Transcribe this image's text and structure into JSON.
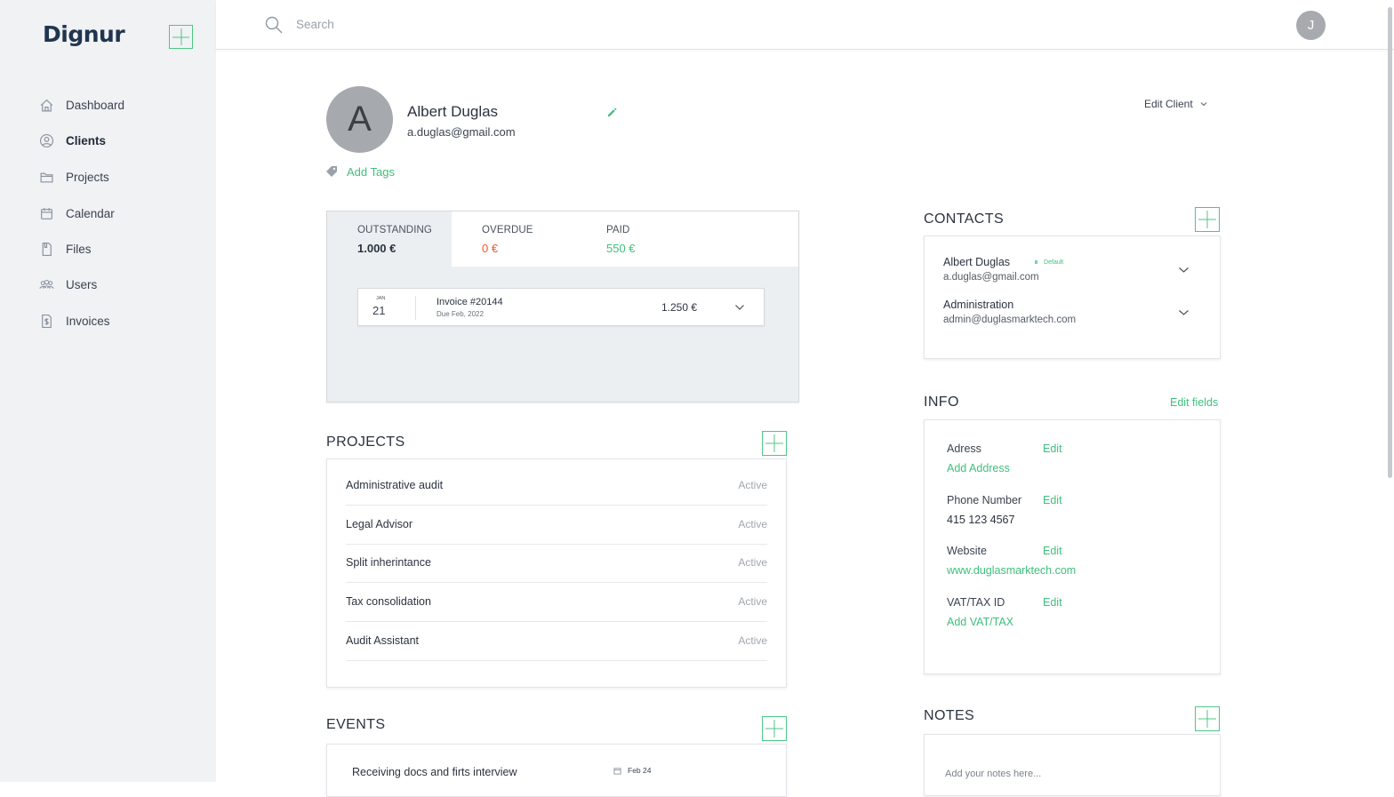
{
  "app": {
    "logo": "Dignur"
  },
  "sidebar": {
    "items": [
      {
        "label": "Dashboard",
        "icon": "home-icon"
      },
      {
        "label": "Clients",
        "icon": "user-circle-icon",
        "active": true
      },
      {
        "label": "Projects",
        "icon": "folder-icon"
      },
      {
        "label": "Calendar",
        "icon": "calendar-icon"
      },
      {
        "label": "Files",
        "icon": "file-icon"
      },
      {
        "label": "Users",
        "icon": "users-icon"
      },
      {
        "label": "Invoices",
        "icon": "invoice-icon"
      }
    ]
  },
  "topbar": {
    "search_placeholder": "Search",
    "user_initial": "J"
  },
  "client": {
    "initial": "A",
    "name": "Albert Duglas",
    "email": "a.duglas@gmail.com",
    "add_tags": "Add Tags",
    "edit_client": "Edit Client"
  },
  "balance": {
    "outstanding_label": "OUTSTANDING",
    "outstanding_value": "1.000 €",
    "overdue_label": "OVERDUE",
    "overdue_value": "0 €",
    "paid_label": "PAID",
    "paid_value": "550 €",
    "invoice": {
      "month": "JAN",
      "day": "21",
      "title": "Invoice #20144",
      "due": "Due Feb, 2022",
      "amount": "1.250 €"
    }
  },
  "projects": {
    "title": "PROJECTS",
    "items": [
      {
        "name": "Administrative audit",
        "status": "Active"
      },
      {
        "name": "Legal Advisor",
        "status": "Active"
      },
      {
        "name": "Split inherintance",
        "status": "Active"
      },
      {
        "name": "Tax consolidation",
        "status": "Active"
      },
      {
        "name": "Audit Assistant",
        "status": "Active"
      }
    ]
  },
  "events": {
    "title": "EVENTS",
    "items": [
      {
        "name": "Receiving docs and firts interview",
        "date": "Feb 24"
      }
    ]
  },
  "contacts": {
    "title": "CONTACTS",
    "items": [
      {
        "name": "Albert Duglas",
        "email": "a.duglas@gmail.com",
        "badge": "Default"
      },
      {
        "name": "Administration",
        "email": "admin@duglasmarktech.com"
      }
    ]
  },
  "info": {
    "title": "INFO",
    "edit_fields": "Edit fields",
    "edit_label": "Edit",
    "address_label": "Adress",
    "address_value": "Add Address",
    "phone_label": "Phone Number",
    "phone_value": "415 123 4567",
    "website_label": "Website",
    "website_value": "www.duglasmarktech.com",
    "vat_label": "VAT/TAX ID",
    "vat_value": "Add VAT/TAX"
  },
  "notes": {
    "title": "NOTES",
    "placeholder": "Add your notes here..."
  },
  "colors": {
    "accent": "#3fbf7d",
    "overdue": "#f0572d",
    "sidebar_bg": "#f0f2f4",
    "brand": "#1f3550"
  }
}
